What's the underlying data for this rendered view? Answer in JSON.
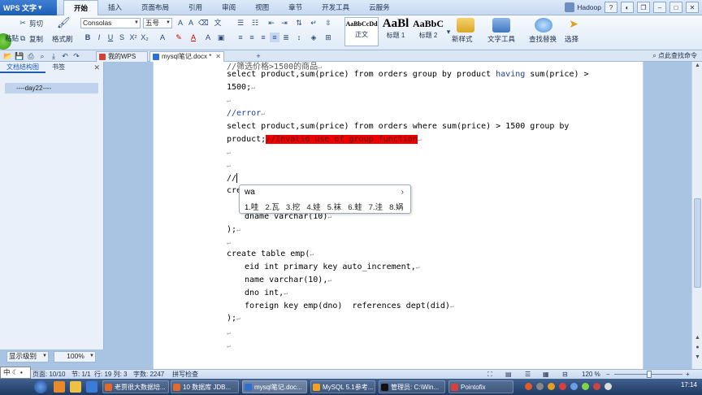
{
  "app": {
    "name": "WPS 文字"
  },
  "menu": {
    "tabs": [
      "开始",
      "插入",
      "页面布局",
      "引用",
      "审阅",
      "视图",
      "章节",
      "开发工具",
      "云服务"
    ],
    "active": "开始"
  },
  "user": {
    "name": "Hadoop"
  },
  "ribbon": {
    "paste": "粘贴",
    "cut": "剪切",
    "copy": "复制",
    "format_painter": "格式刷",
    "font": "Consolas",
    "size": "五号",
    "styles": [
      {
        "preview": "AaBbCcDd",
        "label": "正文"
      },
      {
        "preview": "AaBl",
        "label": "标题 1"
      },
      {
        "preview": "AaBbC",
        "label": "标题 2"
      }
    ],
    "new_style": "新样式",
    "text_tools": "文字工具",
    "find_replace": "查找替换",
    "select": "选择"
  },
  "tabs": {
    "items": [
      {
        "label": "我的WPS",
        "active": false
      },
      {
        "label": "mysql笔记.docx *",
        "active": true
      }
    ],
    "help": "点此查找命令"
  },
  "left_pane": {
    "tabs": [
      "文档结构图",
      "书签"
    ],
    "active": "文档结构图",
    "toc": [
      "----day22----"
    ],
    "show_level": "显示级别",
    "zoom": "100%"
  },
  "document": {
    "lines": {
      "l0": "//筛选价格>1500的商品",
      "l1a": "select product,sum(price) from orders group by product ",
      "l1b": "having",
      "l1c": " sum(price) >",
      "l2": "1500;",
      "l3": "//error",
      "l4": "select product,sum(price) from orders where sum(price) > 1500 group by",
      "l5a": "product;",
      "l5b": "//Invalid use of group function",
      "l6": "//",
      "l7": "cre",
      "l8": "dname varchar(10)",
      "l9": ");",
      "l10": "create table emp(",
      "l11": "eid int primary key auto_increment,",
      "l12": "name varchar(10),",
      "l13": "dno int,",
      "l14": "foreign key emp(dno)  references dept(did)",
      "l15": ");"
    },
    "para_mark": "↵"
  },
  "ime": {
    "input": "wa",
    "candidates": [
      "1.哇",
      "2.瓦",
      "3.挖",
      "4.娃",
      "5.袜",
      "6.蛙",
      "7.洼",
      "8.娲"
    ]
  },
  "status": {
    "page": "页面: 10/10",
    "section": "节: 1/1",
    "row_col": "行: 19  列: 3",
    "word_count": "字数: 2247",
    "spell": "拼写检查",
    "zoom": "120 %",
    "ime_mode": "中"
  },
  "taskbar": {
    "apps": [
      "老贾很大数据培...",
      "10 数据库 JDB...",
      "mysql笔记.doc...",
      "MySQL 5.1参考...",
      "管理员: C:\\Win...",
      "Pointofix"
    ],
    "time": "17:14"
  }
}
